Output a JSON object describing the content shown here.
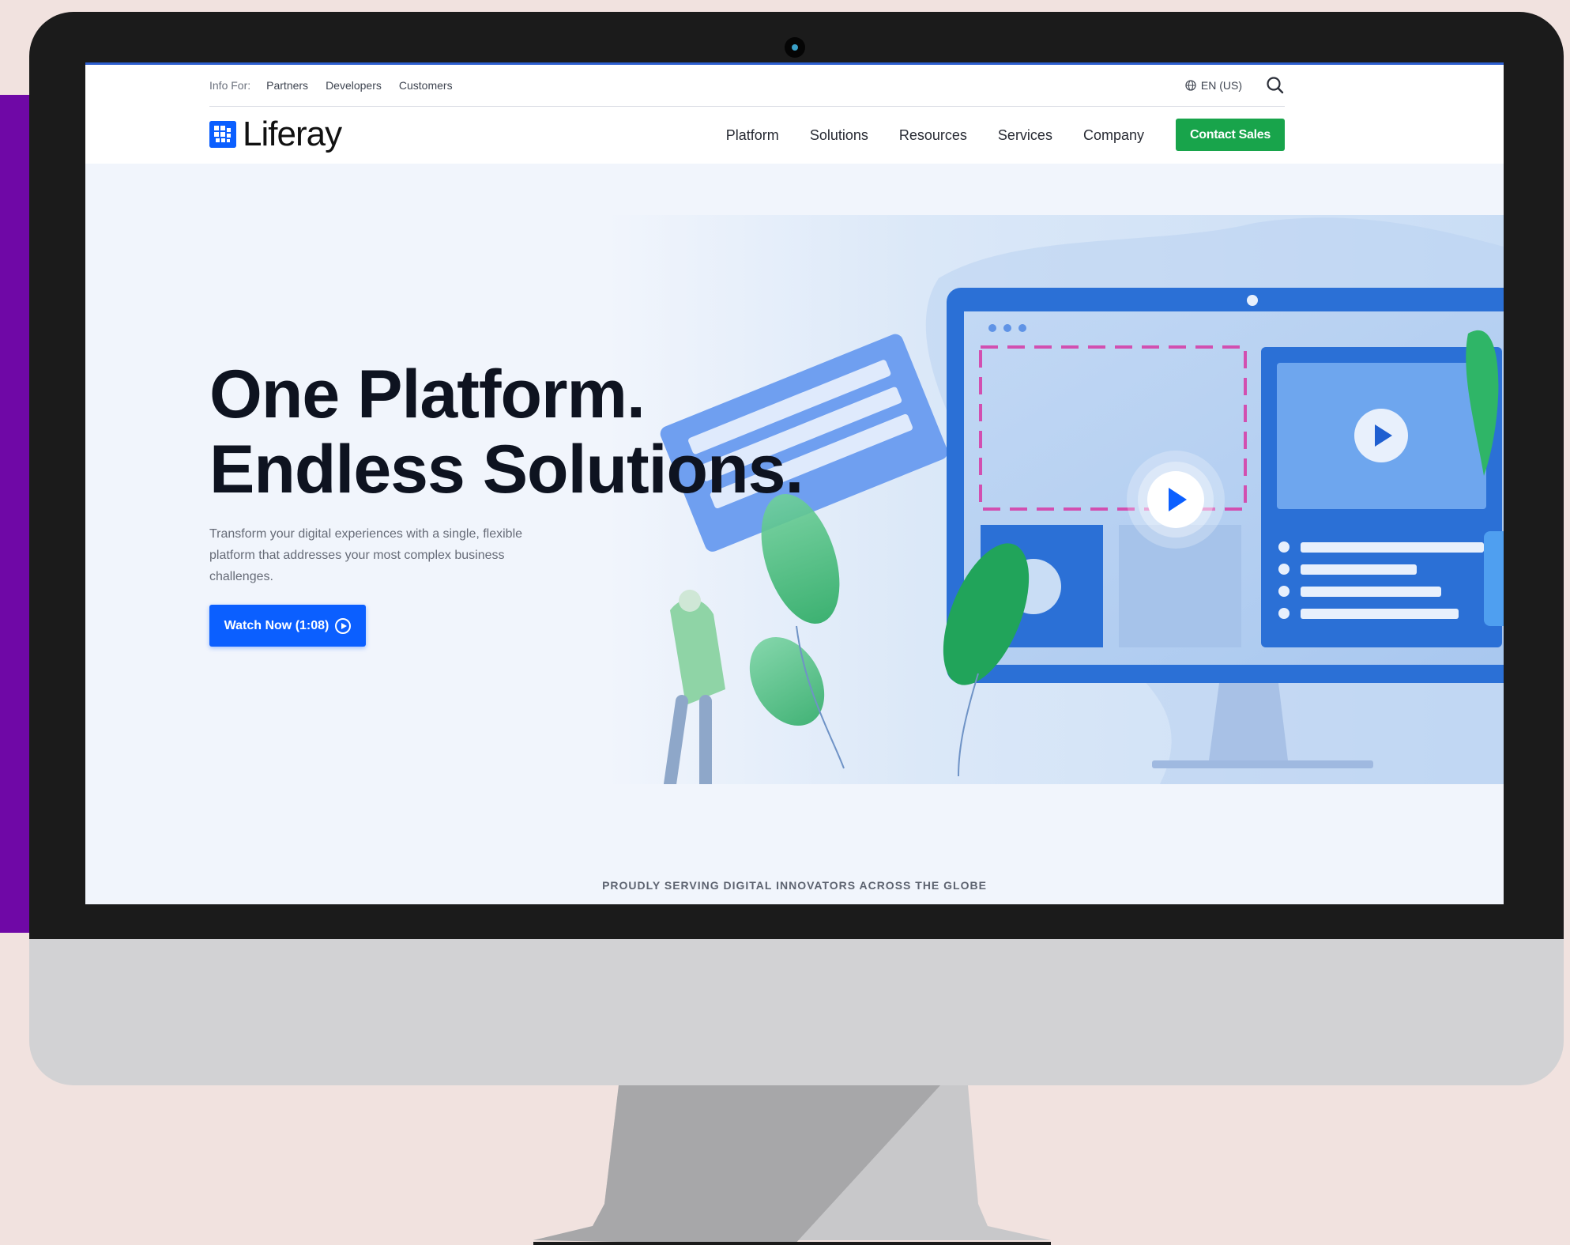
{
  "utility_bar": {
    "info_label": "Info For:",
    "links": [
      "Partners",
      "Developers",
      "Customers"
    ],
    "language": "EN (US)",
    "globe_icon": "globe-icon",
    "search_icon": "search-icon"
  },
  "brand": {
    "name": "Liferay"
  },
  "nav": {
    "items": [
      "Platform",
      "Solutions",
      "Resources",
      "Services",
      "Company"
    ],
    "cta": "Contact Sales"
  },
  "hero": {
    "title_line1": "One Platform.",
    "title_line2": "Endless Solutions.",
    "description": "Transform your digital experiences with a single, flexible platform that addresses your most complex business challenges.",
    "button": "Watch Now (1:08)"
  },
  "footer_strip": {
    "text": "PROUDLY SERVING DIGITAL INNOVATORS ACROSS THE GLOBE"
  },
  "colors": {
    "primary": "#0b5fff",
    "cta_green": "#18a44b",
    "monitor_bezel": "#1b1b1b",
    "background": "#f1e2df",
    "accent_purple": "#6f08a6"
  }
}
